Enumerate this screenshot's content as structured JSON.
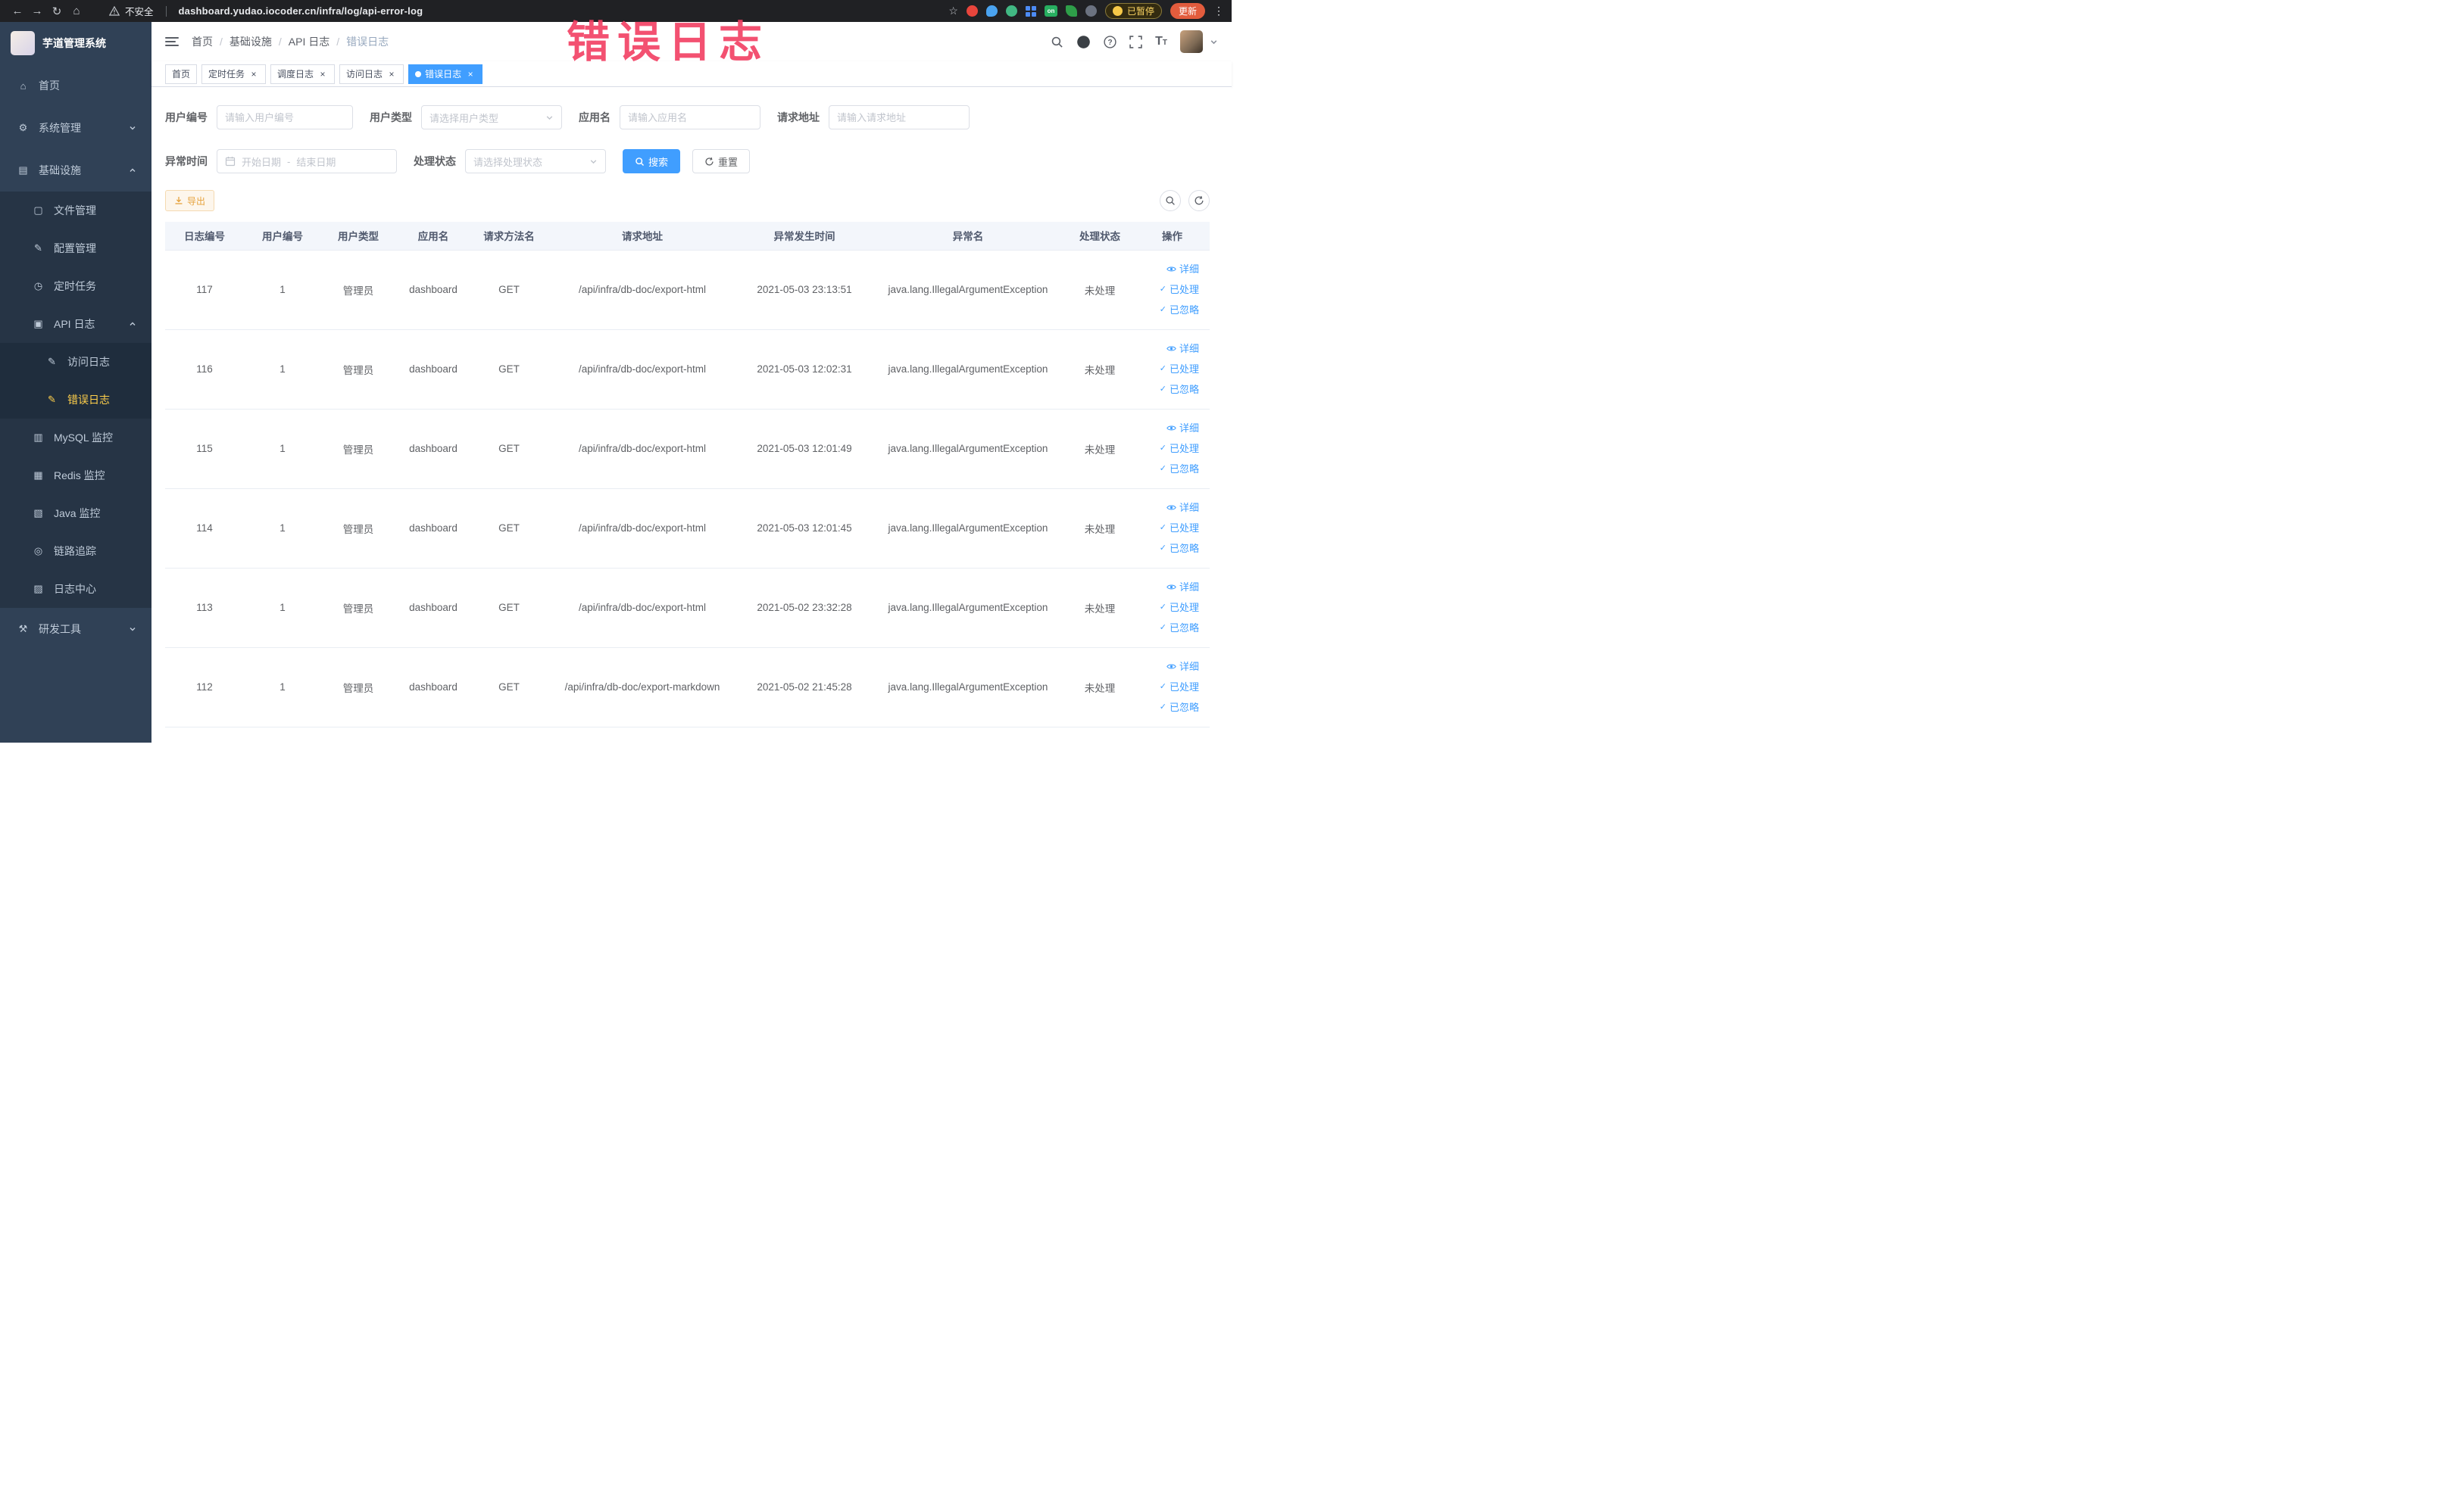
{
  "browser": {
    "security_label": "不安全",
    "url": "dashboard.yudao.iocoder.cn/infra/log/api-error-log",
    "paused_label": "已暂停",
    "update_label": "更新"
  },
  "icons": {
    "back": "←",
    "forward": "→",
    "reload": "↻",
    "home": "⌂",
    "star": "☆",
    "kebab": "⋮",
    "close": "×",
    "check": "✓",
    "question": "?",
    "font_size_large": "T",
    "font_size_small": "T",
    "on_badge": "on",
    "menu_home": "⌂",
    "menu_system": "⚙",
    "menu_infra": "▤",
    "menu_file": "▢",
    "menu_config": "✎",
    "menu_job": "◷",
    "menu_api_log": "▣",
    "menu_access_log": "✎",
    "menu_error_log": "✎",
    "menu_mysql": "▥",
    "menu_redis": "▦",
    "menu_java": "▧",
    "menu_trace": "◎",
    "menu_log_center": "▨",
    "menu_dev_tools": "⚒"
  },
  "annotation": {
    "text": "错误日志"
  },
  "sidebar": {
    "title": "芋道管理系统",
    "items": [
      {
        "label": "首页"
      },
      {
        "label": "系统管理",
        "expanded": false
      },
      {
        "label": "基础设施",
        "expanded": true,
        "children": [
          {
            "label": "文件管理"
          },
          {
            "label": "配置管理"
          },
          {
            "label": "定时任务"
          },
          {
            "label": "API 日志",
            "expanded": true,
            "children": [
              {
                "label": "访问日志"
              },
              {
                "label": "错误日志",
                "active": true
              }
            ]
          },
          {
            "label": "MySQL 监控"
          },
          {
            "label": "Redis 监控"
          },
          {
            "label": "Java 监控"
          },
          {
            "label": "链路追踪"
          },
          {
            "label": "日志中心"
          }
        ]
      },
      {
        "label": "研发工具",
        "expanded": false
      }
    ]
  },
  "breadcrumb": {
    "separator": "/",
    "items": [
      "首页",
      "基础设施",
      "API 日志",
      "错误日志"
    ]
  },
  "tabs": [
    {
      "label": "首页",
      "closable": false,
      "active": false
    },
    {
      "label": "定时任务",
      "closable": true,
      "active": false
    },
    {
      "label": "调度日志",
      "closable": true,
      "active": false
    },
    {
      "label": "访问日志",
      "closable": true,
      "active": false
    },
    {
      "label": "错误日志",
      "closable": true,
      "active": true
    }
  ],
  "filters": {
    "user_id_label": "用户编号",
    "user_id_placeholder": "请输入用户编号",
    "user_type_label": "用户类型",
    "user_type_placeholder": "请选择用户类型",
    "app_name_label": "应用名",
    "app_name_placeholder": "请输入应用名",
    "request_url_label": "请求地址",
    "request_url_placeholder": "请输入请求地址",
    "exception_time_label": "异常时间",
    "start_placeholder": "开始日期",
    "range_separator": "-",
    "end_placeholder": "结束日期",
    "process_status_label": "处理状态",
    "process_status_placeholder": "请选择处理状态",
    "search_label": "搜索",
    "reset_label": "重置"
  },
  "toolbar": {
    "export_label": "导出"
  },
  "table": {
    "columns": [
      "日志编号",
      "用户编号",
      "用户类型",
      "应用名",
      "请求方法名",
      "请求地址",
      "异常发生时间",
      "异常名",
      "处理状态",
      "操作"
    ],
    "action_labels": {
      "detail": "详细",
      "process": "已处理",
      "ignore": "已忽略"
    },
    "rows": [
      {
        "id": "117",
        "user_id": "1",
        "user_type": "管理员",
        "app_name": "dashboard",
        "method": "GET",
        "url": "/api/infra/db-doc/export-html",
        "time": "2021-05-03 23:13:51",
        "exception": "java.lang.IllegalArgumentException",
        "status": "未处理"
      },
      {
        "id": "116",
        "user_id": "1",
        "user_type": "管理员",
        "app_name": "dashboard",
        "method": "GET",
        "url": "/api/infra/db-doc/export-html",
        "time": "2021-05-03 12:02:31",
        "exception": "java.lang.IllegalArgumentException",
        "status": "未处理"
      },
      {
        "id": "115",
        "user_id": "1",
        "user_type": "管理员",
        "app_name": "dashboard",
        "method": "GET",
        "url": "/api/infra/db-doc/export-html",
        "time": "2021-05-03 12:01:49",
        "exception": "java.lang.IllegalArgumentException",
        "status": "未处理"
      },
      {
        "id": "114",
        "user_id": "1",
        "user_type": "管理员",
        "app_name": "dashboard",
        "method": "GET",
        "url": "/api/infra/db-doc/export-html",
        "time": "2021-05-03 12:01:45",
        "exception": "java.lang.IllegalArgumentException",
        "status": "未处理"
      },
      {
        "id": "113",
        "user_id": "1",
        "user_type": "管理员",
        "app_name": "dashboard",
        "method": "GET",
        "url": "/api/infra/db-doc/export-html",
        "time": "2021-05-02 23:32:28",
        "exception": "java.lang.IllegalArgumentException",
        "status": "未处理"
      },
      {
        "id": "112",
        "user_id": "1",
        "user_type": "管理员",
        "app_name": "dashboard",
        "method": "GET",
        "url": "/api/infra/db-doc/export-markdown",
        "time": "2021-05-02 21:45:28",
        "exception": "java.lang.IllegalArgumentException",
        "status": "未处理"
      }
    ]
  },
  "colors": {
    "accent": "#409eff",
    "sidebar_bg": "#304156",
    "menu_active_text": "#ffd04b",
    "warning_text": "#e6a23c",
    "annotation": "#f23e62"
  }
}
